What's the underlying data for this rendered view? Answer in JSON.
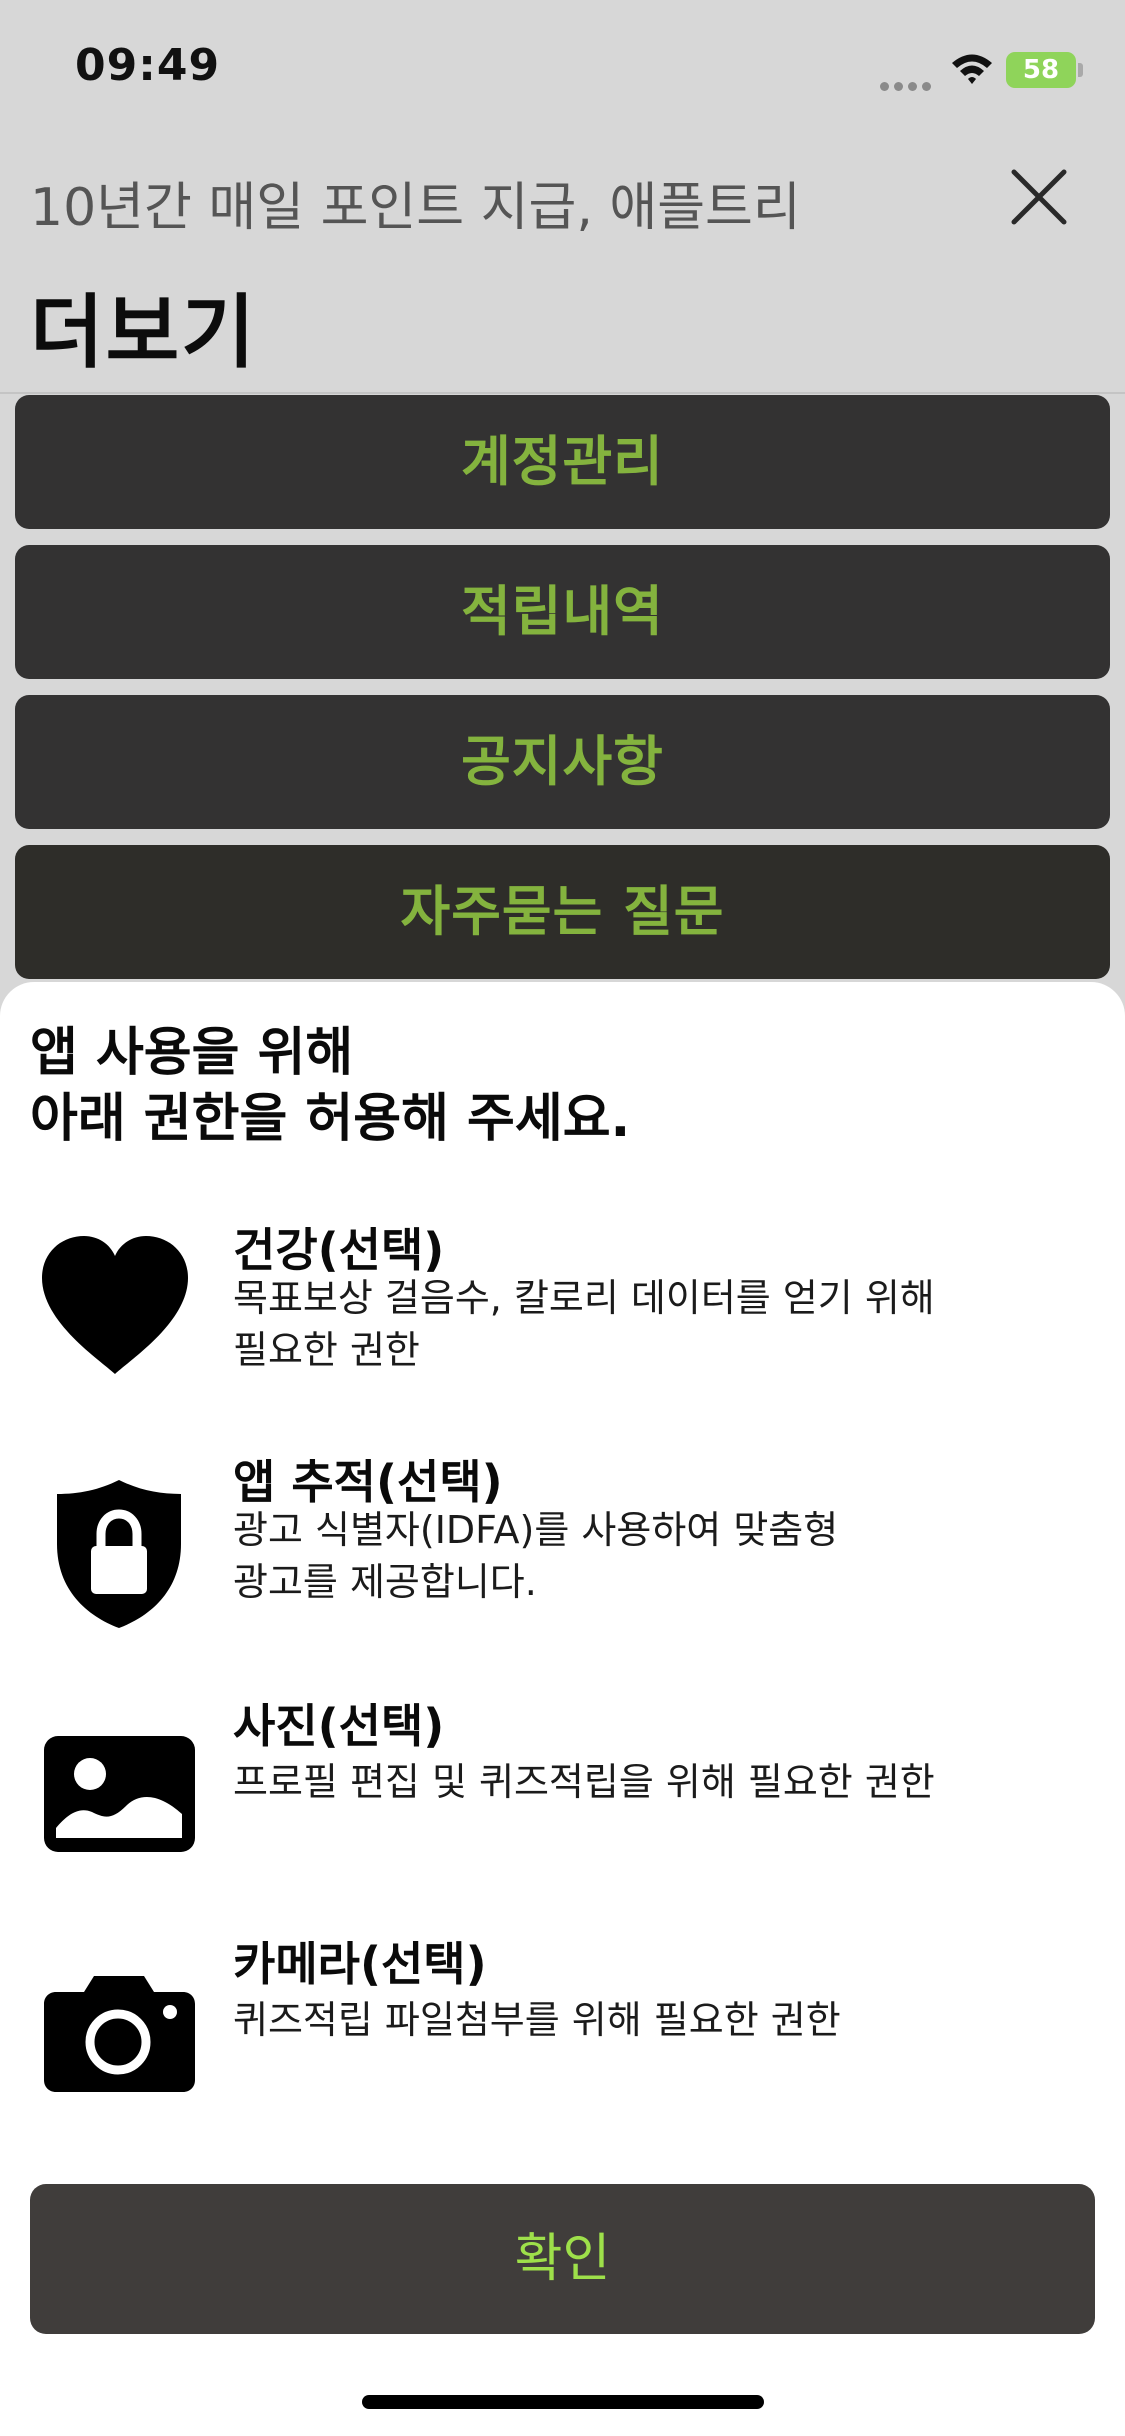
{
  "status_bar": {
    "time": "09:49",
    "battery": "58"
  },
  "nav": {
    "subtitle": "10년간 매일 포인트 지급, 애플트리",
    "title": "더보기"
  },
  "menu": {
    "items": [
      {
        "label": "계정관리"
      },
      {
        "label": "적립내역"
      },
      {
        "label": "공지사항"
      },
      {
        "label": "자주묻는 질문"
      }
    ]
  },
  "sheet": {
    "heading_line1": "앱 사용을 위해",
    "heading_line2": "아래 권한을 허용해 주세요.",
    "permissions": [
      {
        "icon": "heart-icon",
        "title": "건강(선택)",
        "desc_line1": "목표보상 걸음수, 칼로리 데이터를 얻기 위해",
        "desc_line2": "필요한 권한"
      },
      {
        "icon": "shield-lock-icon",
        "title": "앱 추적(선택)",
        "desc_line1": "광고 식별자(IDFA)를 사용하여 맞춤형",
        "desc_line2": "광고를 제공합니다."
      },
      {
        "icon": "photo-icon",
        "title": "사진(선택)",
        "desc_line1": "프로필 편집 및 퀴즈적립을 위해 필요한 권한"
      },
      {
        "icon": "camera-icon",
        "title": "카메라(선택)",
        "desc_line1": "퀴즈적립 파일첨부를 위해 필요한 권한"
      }
    ],
    "confirm_label": "확인"
  },
  "colors": {
    "menu_text": "#84b33e",
    "confirm_text": "#9ee04a",
    "button_bg": "#403d3b"
  }
}
